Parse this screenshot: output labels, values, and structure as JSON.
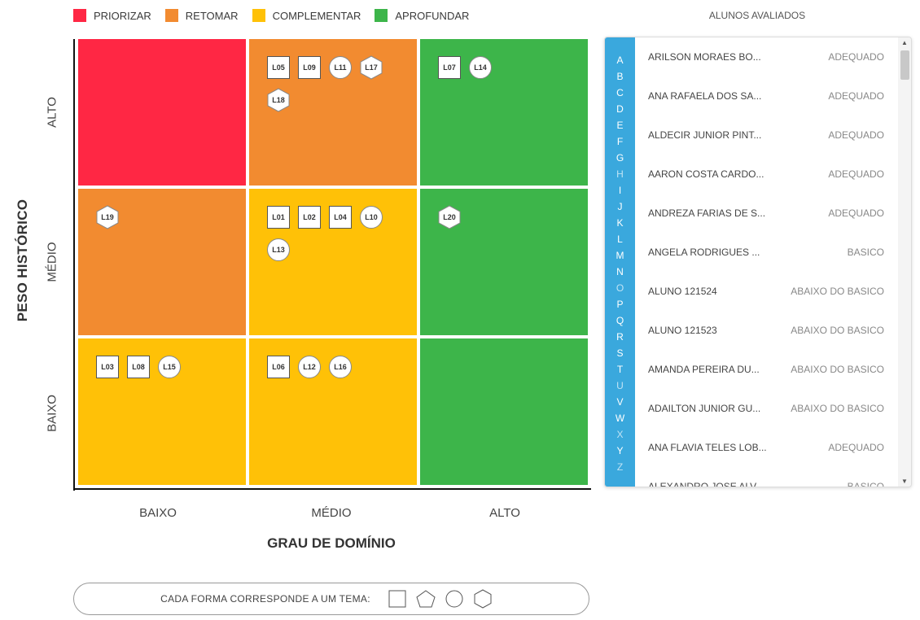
{
  "legend": [
    {
      "label": "PRIORIZAR",
      "color": "#ff2744"
    },
    {
      "label": "RETOMAR",
      "color": "#f28b30"
    },
    {
      "label": "COMPLEMENTAR",
      "color": "#ffc107"
    },
    {
      "label": "APROFUNDAR",
      "color": "#3db54a"
    }
  ],
  "yaxis": {
    "title": "PESO HISTÓRICO",
    "labels": [
      "ALTO",
      "MÉDIO",
      "BAIXO"
    ]
  },
  "xaxis": {
    "title": "GRAU DE DOMÍNIO",
    "labels": [
      "BAIXO",
      "MÉDIO",
      "ALTO"
    ]
  },
  "matrix": [
    {
      "row": "ALTO",
      "col": "BAIXO",
      "category": "PRIORIZAR",
      "color": "#ff2744",
      "markers": []
    },
    {
      "row": "ALTO",
      "col": "MÉDIO",
      "category": "RETOMAR",
      "color": "#f28b30",
      "markers": [
        {
          "id": "L05",
          "shape": "square"
        },
        {
          "id": "L09",
          "shape": "square"
        },
        {
          "id": "L11",
          "shape": "circle"
        },
        {
          "id": "L17",
          "shape": "hexagon"
        },
        {
          "id": "L18",
          "shape": "hexagon"
        }
      ]
    },
    {
      "row": "ALTO",
      "col": "ALTO",
      "category": "APROFUNDAR",
      "color": "#3db54a",
      "markers": [
        {
          "id": "L07",
          "shape": "square"
        },
        {
          "id": "L14",
          "shape": "circle"
        }
      ]
    },
    {
      "row": "MÉDIO",
      "col": "BAIXO",
      "category": "RETOMAR",
      "color": "#f28b30",
      "markers": [
        {
          "id": "L19",
          "shape": "hexagon"
        }
      ]
    },
    {
      "row": "MÉDIO",
      "col": "MÉDIO",
      "category": "COMPLEMENTAR",
      "color": "#ffc107",
      "markers": [
        {
          "id": "L01",
          "shape": "square"
        },
        {
          "id": "L02",
          "shape": "square"
        },
        {
          "id": "L04",
          "shape": "square"
        },
        {
          "id": "L10",
          "shape": "circle"
        },
        {
          "id": "L13",
          "shape": "circle"
        }
      ]
    },
    {
      "row": "MÉDIO",
      "col": "ALTO",
      "category": "APROFUNDAR",
      "color": "#3db54a",
      "markers": [
        {
          "id": "L20",
          "shape": "hexagon"
        }
      ]
    },
    {
      "row": "BAIXO",
      "col": "BAIXO",
      "category": "COMPLEMENTAR",
      "color": "#ffc107",
      "markers": [
        {
          "id": "L03",
          "shape": "square"
        },
        {
          "id": "L08",
          "shape": "square"
        },
        {
          "id": "L15",
          "shape": "circle"
        }
      ]
    },
    {
      "row": "BAIXO",
      "col": "MÉDIO",
      "category": "COMPLEMENTAR",
      "color": "#ffc107",
      "markers": [
        {
          "id": "L06",
          "shape": "square"
        },
        {
          "id": "L12",
          "shape": "circle"
        },
        {
          "id": "L16",
          "shape": "circle"
        }
      ]
    },
    {
      "row": "BAIXO",
      "col": "ALTO",
      "category": "APROFUNDAR",
      "color": "#3db54a",
      "markers": []
    }
  ],
  "students_panel": {
    "title": "ALUNOS AVALIADOS",
    "alphabet": [
      {
        "letter": "A",
        "active": true
      },
      {
        "letter": "B",
        "active": true
      },
      {
        "letter": "C",
        "active": true
      },
      {
        "letter": "D",
        "active": true
      },
      {
        "letter": "E",
        "active": true
      },
      {
        "letter": "F",
        "active": true
      },
      {
        "letter": "G",
        "active": true
      },
      {
        "letter": "H",
        "active": false
      },
      {
        "letter": "I",
        "active": true
      },
      {
        "letter": "J",
        "active": true
      },
      {
        "letter": "K",
        "active": true
      },
      {
        "letter": "L",
        "active": true
      },
      {
        "letter": "M",
        "active": true
      },
      {
        "letter": "N",
        "active": true
      },
      {
        "letter": "O",
        "active": false
      },
      {
        "letter": "P",
        "active": true
      },
      {
        "letter": "Q",
        "active": true
      },
      {
        "letter": "R",
        "active": true
      },
      {
        "letter": "S",
        "active": true
      },
      {
        "letter": "T",
        "active": true
      },
      {
        "letter": "U",
        "active": false
      },
      {
        "letter": "V",
        "active": true
      },
      {
        "letter": "W",
        "active": true
      },
      {
        "letter": "X",
        "active": false
      },
      {
        "letter": "Y",
        "active": true
      },
      {
        "letter": "Z",
        "active": false
      }
    ],
    "students": [
      {
        "name": "ARILSON MORAES BO...",
        "status": "ADEQUADO"
      },
      {
        "name": "ANA RAFAELA DOS SA...",
        "status": "ADEQUADO"
      },
      {
        "name": "ALDECIR JUNIOR PINT...",
        "status": "ADEQUADO"
      },
      {
        "name": "AARON COSTA CARDO...",
        "status": "ADEQUADO"
      },
      {
        "name": "ANDREZA FARIAS DE S...",
        "status": "ADEQUADO"
      },
      {
        "name": "ANGELA RODRIGUES ...",
        "status": "BASICO"
      },
      {
        "name": "ALUNO 121524",
        "status": "ABAIXO DO BASICO"
      },
      {
        "name": "ALUNO 121523",
        "status": "ABAIXO DO BASICO"
      },
      {
        "name": "AMANDA PEREIRA DU...",
        "status": "ABAIXO DO BASICO"
      },
      {
        "name": "ADAILTON JUNIOR GU...",
        "status": "ABAIXO DO BASICO"
      },
      {
        "name": "ANA FLAVIA TELES LOB...",
        "status": "ADEQUADO"
      },
      {
        "name": "ALEXANDRO JOSE ALV...",
        "status": "BASICO"
      }
    ]
  },
  "footer": {
    "text": "CADA FORMA CORRESPONDE A UM TEMA:",
    "shapes": [
      "square-icon",
      "pentagon-icon",
      "circle-icon",
      "hexagon-icon"
    ]
  }
}
